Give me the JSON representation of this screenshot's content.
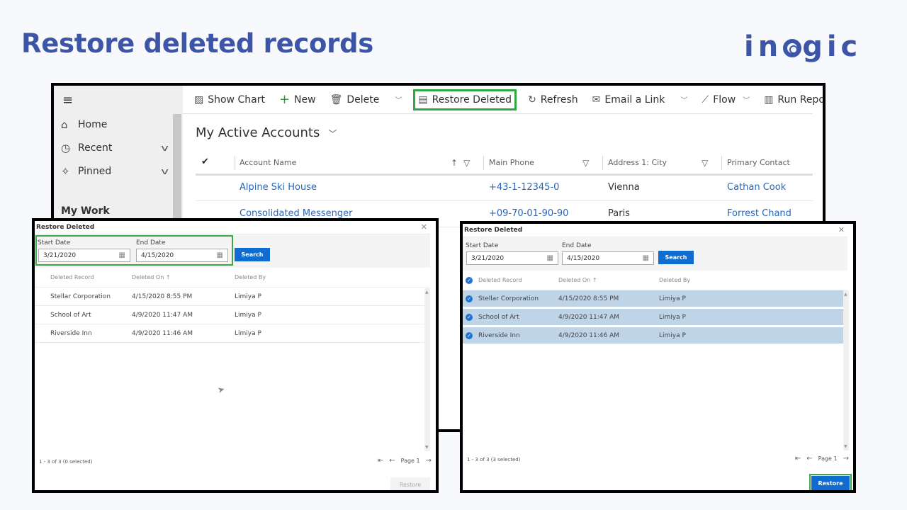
{
  "slide": {
    "title": "Restore deleted records",
    "logo_text_left": "in",
    "logo_text_right": "gic",
    "brand_color": "#3d55a6",
    "highlight_color": "#3ba94a"
  },
  "app": {
    "sidebar": {
      "menu_icon": "hamburger-icon",
      "items": [
        {
          "label": "Home",
          "icon": "home-icon",
          "expandable": false
        },
        {
          "label": "Recent",
          "icon": "clock-icon",
          "expandable": true
        },
        {
          "label": "Pinned",
          "icon": "pin-icon",
          "expandable": true
        }
      ],
      "section": "My Work"
    },
    "command_bar": [
      {
        "label": "Show Chart",
        "icon": "chart-icon"
      },
      {
        "label": "New",
        "icon": "plus-icon"
      },
      {
        "label": "Delete",
        "icon": "trash-icon",
        "dropdown": true
      },
      {
        "label": "Restore Deleted",
        "icon": "restore-icon",
        "highlighted": true
      },
      {
        "label": "Refresh",
        "icon": "refresh-icon"
      },
      {
        "label": "Email a Link",
        "icon": "email-icon",
        "dropdown": true
      },
      {
        "label": "Flow",
        "icon": "flow-icon",
        "dropdown": true
      },
      {
        "label": "Run Report",
        "icon": "report-icon",
        "dropdown": true
      }
    ],
    "view_title": "My Active Accounts",
    "grid": {
      "columns": [
        "Account Name",
        "Main Phone",
        "Address 1: City",
        "Primary Contact"
      ],
      "rows": [
        {
          "name": "Alpine Ski House",
          "phone": "+43-1-12345-0",
          "city": "Vienna",
          "contact": "Cathan Cook"
        },
        {
          "name": "Consolidated Messenger",
          "phone": "+09-70-01-90-90",
          "city": "Paris",
          "contact": "Forrest Chand"
        }
      ]
    }
  },
  "dialogs": [
    {
      "title": "Restore Deleted",
      "start_label": "Start Date",
      "start_value": "3/21/2020",
      "end_label": "End Date",
      "end_value": "4/15/2020",
      "search_label": "Search",
      "columns": [
        "Deleted Record",
        "Deleted On ↑",
        "Deleted By"
      ],
      "rows": [
        {
          "record": "Stellar Corporation",
          "on": "4/15/2020 8:55 PM",
          "by": "Limiya P",
          "selected": false
        },
        {
          "record": "School of Art",
          "on": "4/9/2020 11:47 AM",
          "by": "Limiya P",
          "selected": false
        },
        {
          "record": "Riverside Inn",
          "on": "4/9/2020 11:46 AM",
          "by": "Limiya P",
          "selected": false
        }
      ],
      "footer_count": "1 - 3 of 3 (0 selected)",
      "page_label": "Page 1",
      "restore_label": "Restore",
      "restore_enabled": false
    },
    {
      "title": "Restore Deleted",
      "start_label": "Start Date",
      "start_value": "3/21/2020",
      "end_label": "End Date",
      "end_value": "4/15/2020",
      "search_label": "Search",
      "columns": [
        "Deleted Record",
        "Deleted On ↑",
        "Deleted By"
      ],
      "rows": [
        {
          "record": "Stellar Corporation",
          "on": "4/15/2020 8:55 PM",
          "by": "Limiya P",
          "selected": true
        },
        {
          "record": "School of Art",
          "on": "4/9/2020 11:47 AM",
          "by": "Limiya P",
          "selected": true
        },
        {
          "record": "Riverside Inn",
          "on": "4/9/2020 11:46 AM",
          "by": "Limiya P",
          "selected": true
        }
      ],
      "footer_count": "1 - 3 of 3 (3 selected)",
      "page_label": "Page 1",
      "restore_label": "Restore",
      "restore_enabled": true
    }
  ]
}
